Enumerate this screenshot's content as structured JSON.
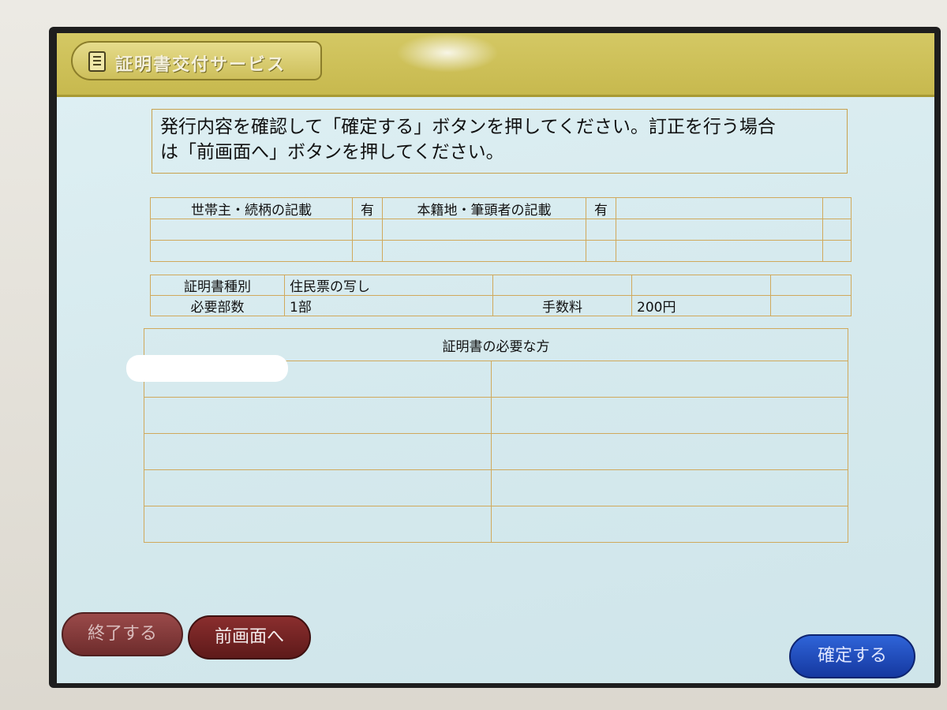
{
  "header": {
    "title": "証明書交付サービス",
    "icon": "document-list-icon"
  },
  "instruction": {
    "line1": "発行内容を確認して「確定する」ボタンを押してください。訂正を行う場合",
    "line2": "は「前画面へ」ボタンを押してください。"
  },
  "options": {
    "household_label": "世帯主・続柄の記載",
    "household_value": "有",
    "domicile_label": "本籍地・筆頭者の記載",
    "domicile_value": "有"
  },
  "certificate": {
    "type_label": "証明書種別",
    "type_value": "住民票の写し",
    "copies_label": "必要部数",
    "copies_value": "1部",
    "fee_label": "手数料",
    "fee_value": "200円"
  },
  "persons": {
    "header": "証明書の必要な方"
  },
  "buttons": {
    "end": "終了する",
    "back": "前画面へ",
    "confirm": "確定する"
  },
  "colors": {
    "titlebar": "#c7b94e",
    "screen_bg": "#d6eaee",
    "grid_line": "#d0a95c",
    "end_button": "#7e3838",
    "back_button": "#6e2020",
    "confirm_button": "#1f4cc0"
  }
}
